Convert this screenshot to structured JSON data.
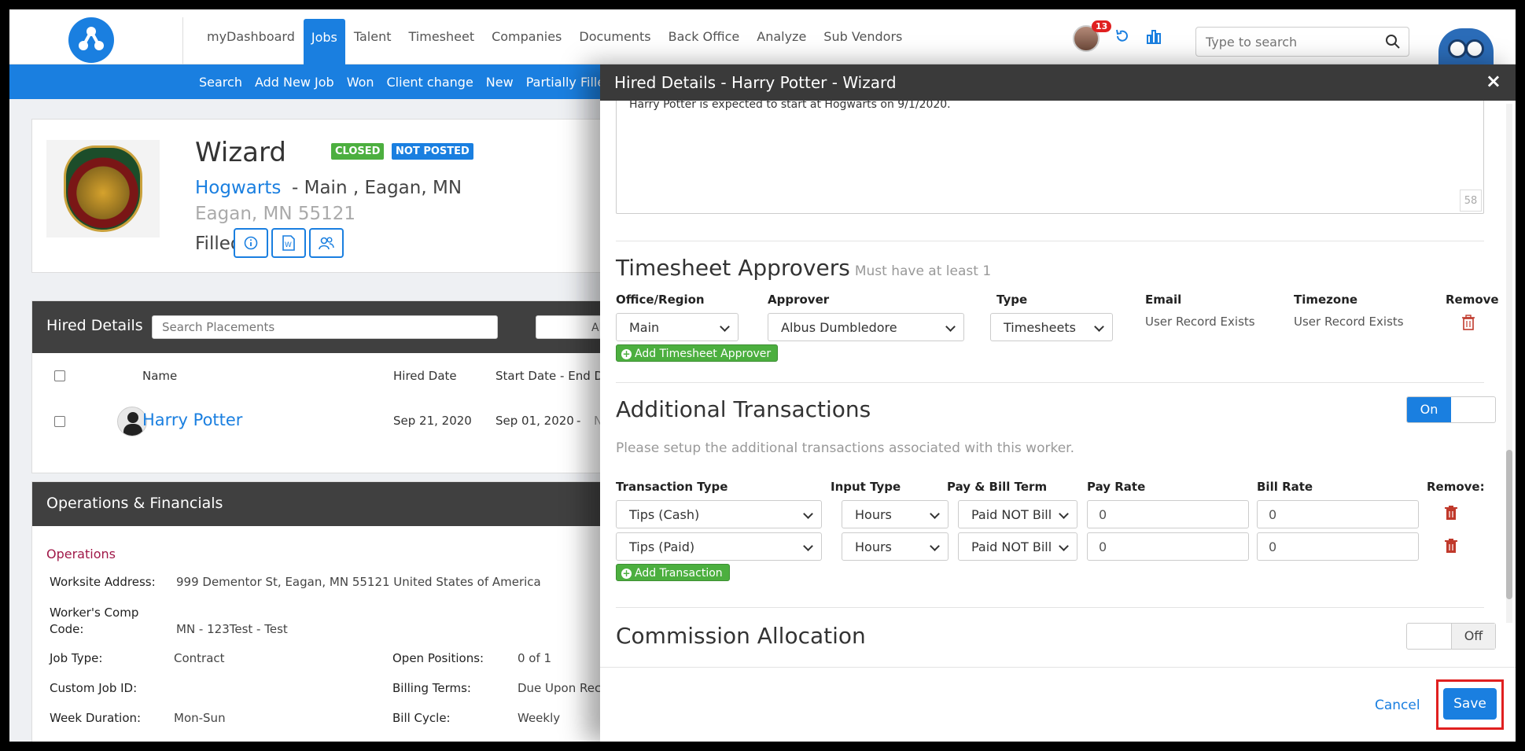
{
  "nav": {
    "items": [
      "myDashboard",
      "Jobs",
      "Talent",
      "Timesheet",
      "Companies",
      "Documents",
      "Back Office",
      "Analyze",
      "Sub Vendors"
    ],
    "active": "Jobs",
    "notification_count": "13",
    "search_placeholder": "Type to search"
  },
  "subnav": {
    "items": [
      "Search",
      "Add New Job",
      "Won",
      "Client change",
      "New",
      "Partially Filled"
    ]
  },
  "job": {
    "title": "Wizard",
    "status_closed": "CLOSED",
    "status_posted": "NOT POSTED",
    "company": "Hogwarts",
    "location": "- Main , Eagan, MN",
    "city": "Eagan, MN 55121",
    "fill_status": "Filled"
  },
  "hired_details": {
    "title": "Hired Details",
    "search_placeholder": "Search Placements",
    "filter_label": "All",
    "columns": {
      "name": "Name",
      "hired_date": "Hired Date",
      "start_end": "Start Date - End Da"
    },
    "row": {
      "name": "Harry Potter",
      "hired_date": "Sep 21, 2020",
      "start_date": "Sep 01, 2020",
      "dash": "-",
      "end": "No"
    }
  },
  "operations": {
    "title": "Operations & Financials",
    "section": "Operations",
    "worksite_label": "Worksite Address:",
    "worksite_value": "999 Dementor St, Eagan, MN 55121 United States of America",
    "wc_label_1": "Worker's Comp",
    "wc_label_2": "Code:",
    "wc_value": "MN - 123Test - Test",
    "job_type_label": "Job Type:",
    "job_type_value": "Contract",
    "open_positions_label": "Open Positions:",
    "open_positions_value": "0 of 1",
    "custom_id_label": "Custom Job ID:",
    "billing_terms_label": "Billing Terms:",
    "billing_terms_value": "Due Upon Rece",
    "week_duration_label": "Week Duration:",
    "week_duration_value": "Mon-Sun",
    "bill_cycle_label": "Bill Cycle:",
    "bill_cycle_value": "Weekly"
  },
  "modal": {
    "title": "Hired Details - Harry Potter - Wizard",
    "close": "×",
    "note_text": "Harry Potter is expected to start at Hogwarts on 9/1/2020.",
    "char_count": "58",
    "approvers": {
      "title": "Timesheet Approvers",
      "subtitle": "Must have at least 1",
      "col_office": "Office/Region",
      "col_approver": "Approver",
      "col_type": "Type",
      "col_email": "Email",
      "col_timezone": "Timezone",
      "col_remove": "Remove",
      "office_value": "Main",
      "approver_value": "Albus Dumbledore",
      "type_value": "Timesheets",
      "email_value": "User Record Exists",
      "timezone_value": "User Record Exists",
      "add_button": "Add Timesheet Approver"
    },
    "transactions": {
      "title": "Additional Transactions",
      "toggle_on": "On",
      "description": "Please setup the additional transactions associated with this worker.",
      "col_type": "Transaction Type",
      "col_input": "Input Type",
      "col_term": "Pay & Bill Term",
      "col_pay": "Pay Rate",
      "col_bill": "Bill Rate",
      "col_remove": "Remove:",
      "rows": [
        {
          "type": "Tips (Cash)",
          "input": "Hours",
          "term": "Paid NOT Bill",
          "pay": "0",
          "bill": "0"
        },
        {
          "type": "Tips (Paid)",
          "input": "Hours",
          "term": "Paid NOT Bill",
          "pay": "0",
          "bill": "0"
        }
      ],
      "add_button": "Add Transaction"
    },
    "commission": {
      "title": "Commission Allocation",
      "toggle_off": "Off"
    },
    "cancel": "Cancel",
    "save": "Save"
  }
}
